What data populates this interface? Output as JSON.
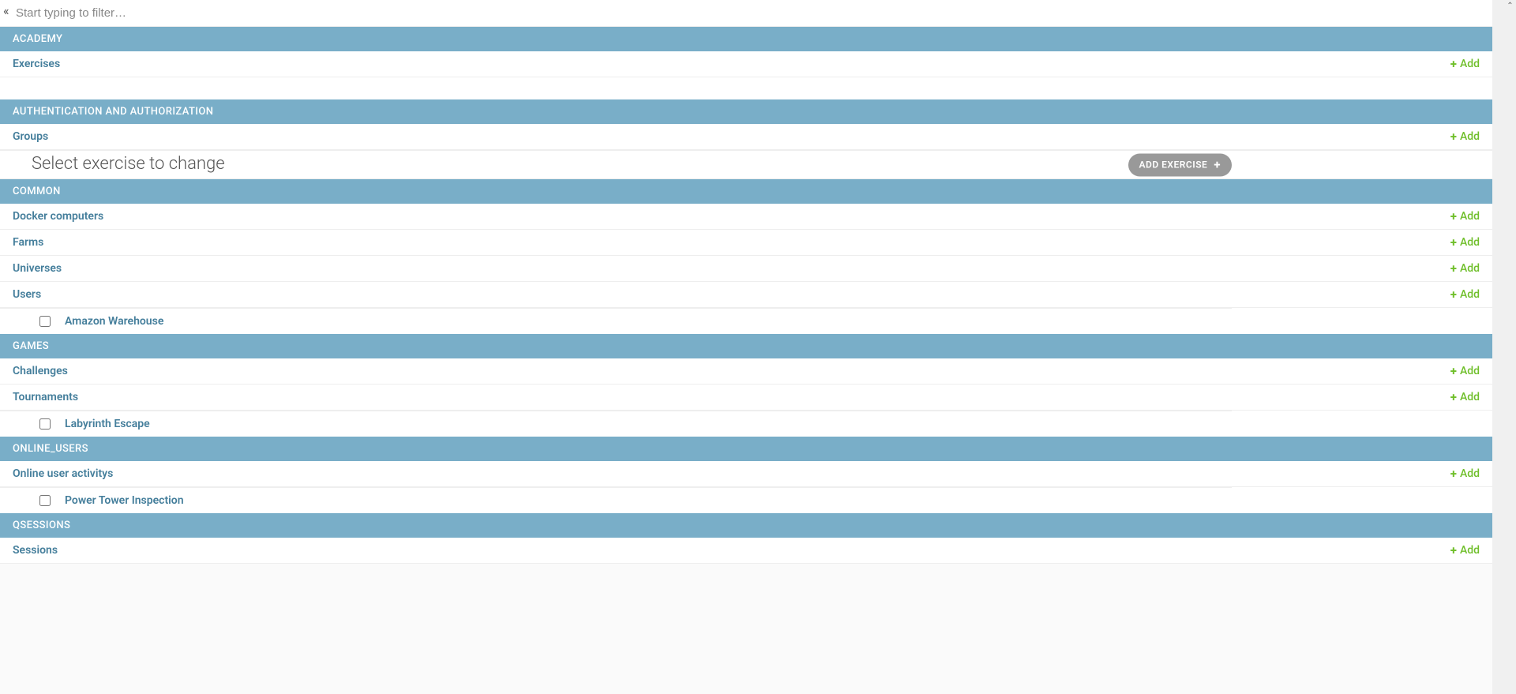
{
  "filter": {
    "placeholder": "Start typing to filter…"
  },
  "add_label": "Add",
  "hero": {
    "title": "Select exercise to change",
    "button": "ADD EXERCISE"
  },
  "sections": {
    "academy": {
      "title": "ACADEMY",
      "models": [
        "Exercises"
      ]
    },
    "auth": {
      "title": "AUTHENTICATION AND AUTHORIZATION",
      "models": [
        "Groups"
      ]
    },
    "common": {
      "title": "COMMON",
      "models": [
        "Docker computers",
        "Farms",
        "Universes",
        "Users"
      ]
    },
    "games": {
      "title": "GAMES",
      "models": [
        "Challenges",
        "Tournaments"
      ]
    },
    "online_users": {
      "title": "ONLINE_USERS",
      "models": [
        "Online user activitys"
      ]
    },
    "qsessions": {
      "title": "QSESSIONS",
      "models": [
        "Sessions"
      ]
    }
  },
  "items": {
    "after_users": "Amazon Warehouse",
    "after_tournaments": "Labyrinth Escape",
    "after_online": "Power Tower Inspection"
  }
}
